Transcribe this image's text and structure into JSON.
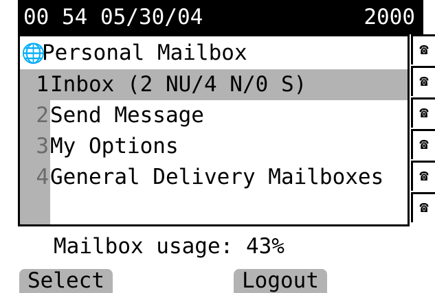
{
  "status_bar": {
    "datetime": "00 54 05/30/04",
    "extension": "2000"
  },
  "menu": {
    "title": "Personal Mailbox",
    "title_icon": "globe-icon",
    "items": [
      {
        "number": "1",
        "label": "Inbox (2 NU/4 N/0 S)",
        "selected": true
      },
      {
        "number": "2",
        "label": "Send Message",
        "selected": false
      },
      {
        "number": "3",
        "label": "My Options",
        "selected": false
      },
      {
        "number": "4",
        "label": "General Delivery Mailboxes",
        "selected": false
      }
    ]
  },
  "line_keys": {
    "icon": "phone-icon",
    "count": 6
  },
  "footer": {
    "usage_text": "Mailbox usage: 43%"
  },
  "softkeys": {
    "select": "Select",
    "logout": "Logout"
  },
  "colors": {
    "highlight": "#b3b3b3",
    "status_bar_bg": "#000000",
    "text": "#000000"
  }
}
